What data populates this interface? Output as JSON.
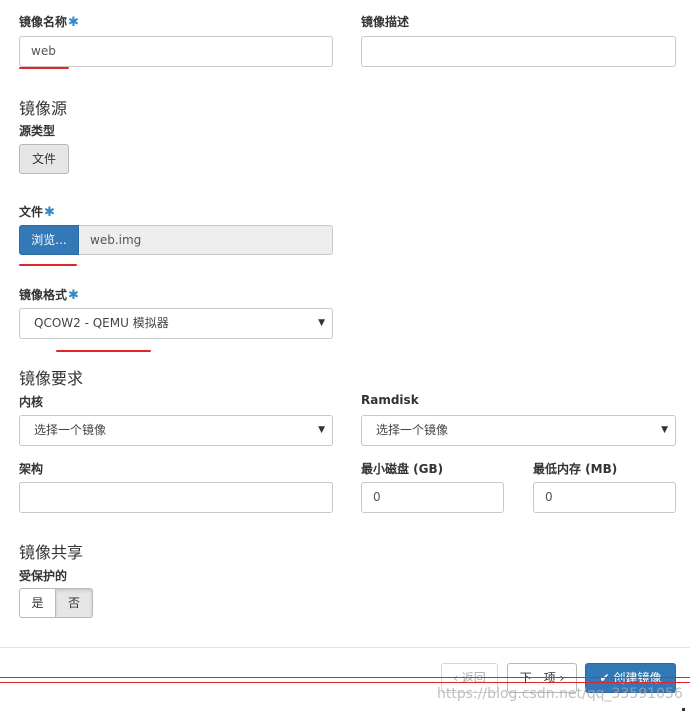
{
  "fields": {
    "image_name": {
      "label": "镜像名称",
      "required_mark": "✱",
      "value": "web"
    },
    "image_description": {
      "label": "镜像描述",
      "value": ""
    },
    "file": {
      "label": "文件",
      "required_mark": "✱",
      "browse_label": "浏览...",
      "filename": "web.img"
    },
    "image_format": {
      "label": "镜像格式",
      "required_mark": "✱",
      "selected": "QCOW2 - QEMU 模拟器"
    },
    "kernel": {
      "label": "内核",
      "selected": "选择一个镜像"
    },
    "ramdisk": {
      "label": "Ramdisk",
      "selected": "选择一个镜像"
    },
    "architecture": {
      "label": "架构",
      "value": ""
    },
    "min_disk": {
      "label": "最小磁盘 (GB)",
      "value": "0"
    },
    "min_memory": {
      "label": "最低内存 (MB)",
      "value": "0"
    },
    "protected": {
      "label": "受保护的",
      "options": [
        "是",
        "否"
      ],
      "selected": "否"
    }
  },
  "sections": {
    "image_source": "镜像源",
    "source_type_label": "源类型",
    "source_type_option": "文件",
    "image_requirements": "镜像要求",
    "image_sharing": "镜像共享"
  },
  "footer": {
    "back_label": "‹ 返回",
    "next_label": "下一项 ›",
    "create_label": "创建镜像"
  },
  "watermark": "https://blog.csdn.net/qq_33591056",
  "colors": {
    "primary": "#3379b7",
    "required_mark": "#2f89c9",
    "annotation_red": "#e0252b"
  }
}
